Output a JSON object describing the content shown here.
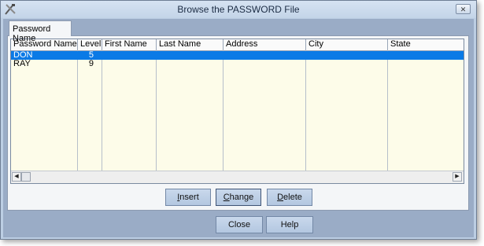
{
  "window": {
    "title": "Browse the PASSWORD File",
    "close_glyph": "✕"
  },
  "tabs": [
    {
      "label": "Password Name"
    }
  ],
  "grid": {
    "columns": [
      "Password Name",
      "Level",
      "First Name",
      "Last Name",
      "Address",
      "City",
      "State"
    ],
    "rows": [
      {
        "password_name": "DON",
        "level": "5",
        "first_name": "",
        "last_name": "",
        "address": "",
        "city": "",
        "state": "",
        "selected": true
      },
      {
        "password_name": "RAY",
        "level": "9",
        "first_name": "",
        "last_name": "",
        "address": "",
        "city": "",
        "state": "",
        "selected": false
      }
    ],
    "scroll_left_glyph": "◀",
    "scroll_right_glyph": "▶"
  },
  "buttons": {
    "insert": {
      "mnemonic": "I",
      "rest": "nsert"
    },
    "change": {
      "mnemonic": "C",
      "rest": "hange"
    },
    "delete": {
      "mnemonic": "D",
      "rest": "elete"
    },
    "close": "Close",
    "help": "Help"
  },
  "icons": {
    "app": "tools-icon",
    "close": "close-icon"
  },
  "colors": {
    "selection": "#0a7ae6",
    "grid_background": "#fdfce9",
    "window_background": "#9aacc6"
  }
}
